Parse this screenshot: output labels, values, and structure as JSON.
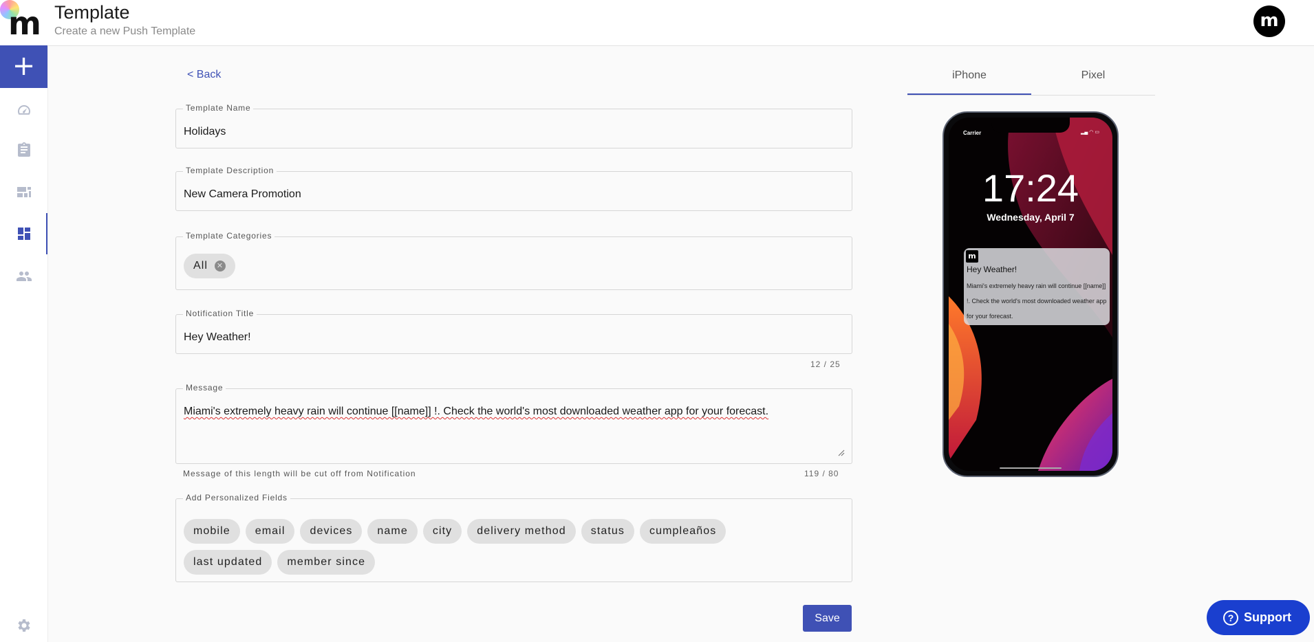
{
  "header": {
    "title": "Template",
    "subtitle": "Create a new Push Template",
    "logo_letter": "m",
    "avatar_letter": "m"
  },
  "sidebar": {
    "add_label": "+",
    "items": [
      {
        "icon": "dashboard-gauge-icon"
      },
      {
        "icon": "clipboard-icon"
      },
      {
        "icon": "campaigns-icon"
      },
      {
        "icon": "templates-grid-icon",
        "active": true
      },
      {
        "icon": "people-icon"
      }
    ],
    "settings_icon": "gear-icon"
  },
  "form": {
    "back_label": "< Back",
    "template_name": {
      "label": "Template Name",
      "value": "Holidays"
    },
    "template_description": {
      "label": "Template Description",
      "value": "New Camera Promotion"
    },
    "template_categories": {
      "label": "Template Categories",
      "chips": [
        "All"
      ]
    },
    "notification_title": {
      "label": "Notification Title",
      "value": "Hey Weather!",
      "counter": "12 / 25"
    },
    "message": {
      "label": "Message",
      "value": "Miami's extremely heavy rain will continue [[name]] !. Check the world's most downloaded weather app for your forecast.",
      "hint": "Message of this length will be cut off from Notification",
      "counter": "119 / 80"
    },
    "personalized_fields": {
      "label": "Add Personalized Fields",
      "chips": [
        "mobile",
        "email",
        "devices",
        "name",
        "city",
        "delivery method",
        "status",
        "cumpleaños",
        "last updated",
        "member since"
      ]
    },
    "save_label": "Save"
  },
  "preview": {
    "tabs": [
      "iPhone",
      "Pixel"
    ],
    "active_tab": "iPhone",
    "carrier": "Carrier",
    "time": "17:24",
    "date": "Wednesday, April 7",
    "notification": {
      "app_letter": "m",
      "title": "Hey Weather!",
      "body": "Miami's extremely heavy rain will continue [[name]] !. Check the world's most downloaded weather app for your forecast."
    }
  },
  "support": {
    "label": "Support",
    "icon": "?"
  },
  "colors": {
    "accent": "#3f51b5",
    "support": "#1a3fcf"
  }
}
